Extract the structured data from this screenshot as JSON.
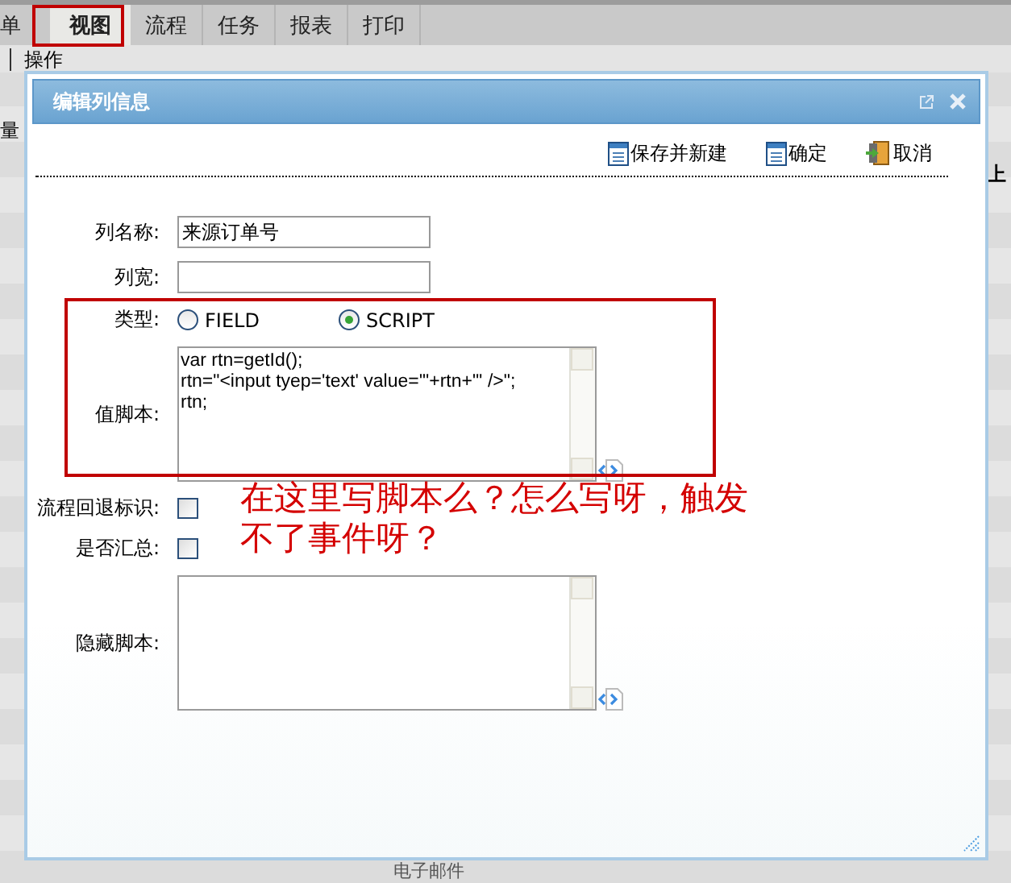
{
  "tabs": [
    {
      "label": "单",
      "selected": false
    },
    {
      "label": "视图",
      "selected": true
    },
    {
      "label": "流程",
      "selected": false
    },
    {
      "label": "任务",
      "selected": false
    },
    {
      "label": "报表",
      "selected": false
    },
    {
      "label": "打印",
      "selected": false
    }
  ],
  "subbar": {
    "label": "操作"
  },
  "background": {
    "left_text": "量",
    "right_text": "上",
    "footer_text": "电子邮件"
  },
  "dialog": {
    "title": "编辑列信息",
    "actions": [
      {
        "label": "保存并新建",
        "kind": "save"
      },
      {
        "label": "确定",
        "kind": "save"
      },
      {
        "label": "取消",
        "kind": "exit"
      }
    ],
    "fields": [
      {
        "kind": "text",
        "label": "列名称:",
        "value": "来源订单号"
      },
      {
        "kind": "text",
        "label": "列宽:"
      },
      {
        "kind": "radio",
        "label": "类型:",
        "options": [
          {
            "label": "FIELD",
            "selected": false
          },
          {
            "label": "SCRIPT",
            "selected": true
          }
        ]
      },
      {
        "kind": "script",
        "label": "值脚本:",
        "value": "var rtn=getId();\nrtn=\"<input tyep='text' value='\"+rtn+\"' />\";\nrtn;"
      },
      {
        "kind": "checkbox",
        "label": "流程回退标识:",
        "checked": false
      },
      {
        "kind": "checkbox",
        "label": "是否汇总:",
        "checked": false
      },
      {
        "kind": "script",
        "label": "隐藏脚本:"
      }
    ]
  },
  "annotation": {
    "text": "在这里写脚本么？怎么写呀，触发不了事件呀？"
  }
}
